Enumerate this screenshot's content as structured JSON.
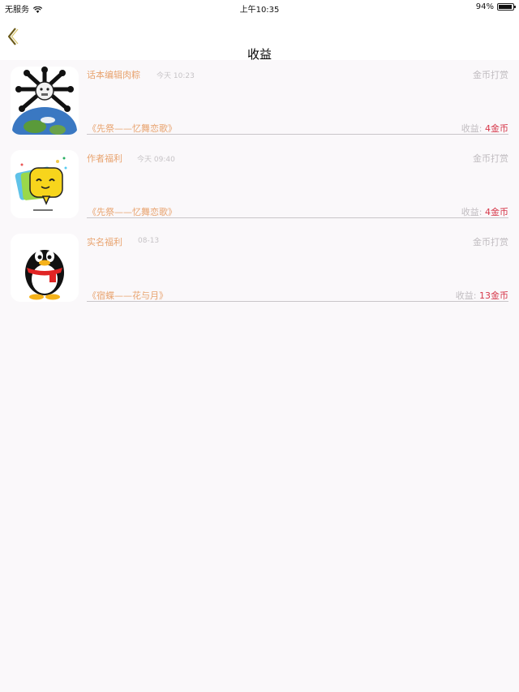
{
  "status_bar": {
    "carrier": "无服务",
    "time": "上午10:35",
    "battery": "94%",
    "battery_level": 0.94
  },
  "nav": {
    "title": "收益"
  },
  "income_label": "收益:",
  "items": [
    {
      "name": "话本编辑肉粽",
      "time": "今天 10:23",
      "type": "金币打赏",
      "book": "《先祭——忆舞恋歌》",
      "amount": "4金币",
      "avatar": "skull-earth-avatar"
    },
    {
      "name": "作者福利",
      "time": "今天 09:40",
      "type": "金币打赏",
      "book": "《先祭——忆舞恋歌》",
      "amount": "4金币",
      "avatar": "chat-bubble-avatar"
    },
    {
      "name": "实名福利",
      "time": "08-13",
      "type": "金币打赏",
      "book": "《宿蝶——花与月》",
      "amount": "13金币",
      "avatar": "qq-penguin-avatar"
    }
  ]
}
